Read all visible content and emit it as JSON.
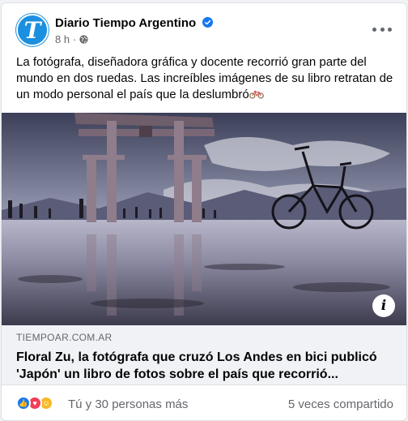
{
  "page": {
    "name": "Diario Tiempo Argentino",
    "avatar_letter": "T",
    "time": "8 h",
    "separator": "·"
  },
  "post": {
    "text": "La fotógrafa, diseñadora gráfica y docente recorrió gran parte del mundo en dos ruedas. Las increíbles imágenes de su libro retratan de un modo personal el país que la deslumbró"
  },
  "link": {
    "domain": "TIEMPOAR.COM.AR",
    "title": "Floral Zu, la fotógrafa que cruzó Los Andes en bici publicó 'Japón' un libro de fotos sobre el país que recorrió..."
  },
  "stats": {
    "reactions": "Tú y 30 personas más",
    "shares": "5 veces compartido"
  },
  "icons": [
    "verified-icon",
    "globe-icon",
    "more-icon",
    "bicycle-emoji",
    "info-icon",
    "like-icon",
    "love-icon",
    "care-icon"
  ],
  "colors": {
    "brand": "#1877f2",
    "avatar": "#1b8fe0",
    "muted": "#65676b",
    "preview_bg": "#f0f2f5"
  }
}
